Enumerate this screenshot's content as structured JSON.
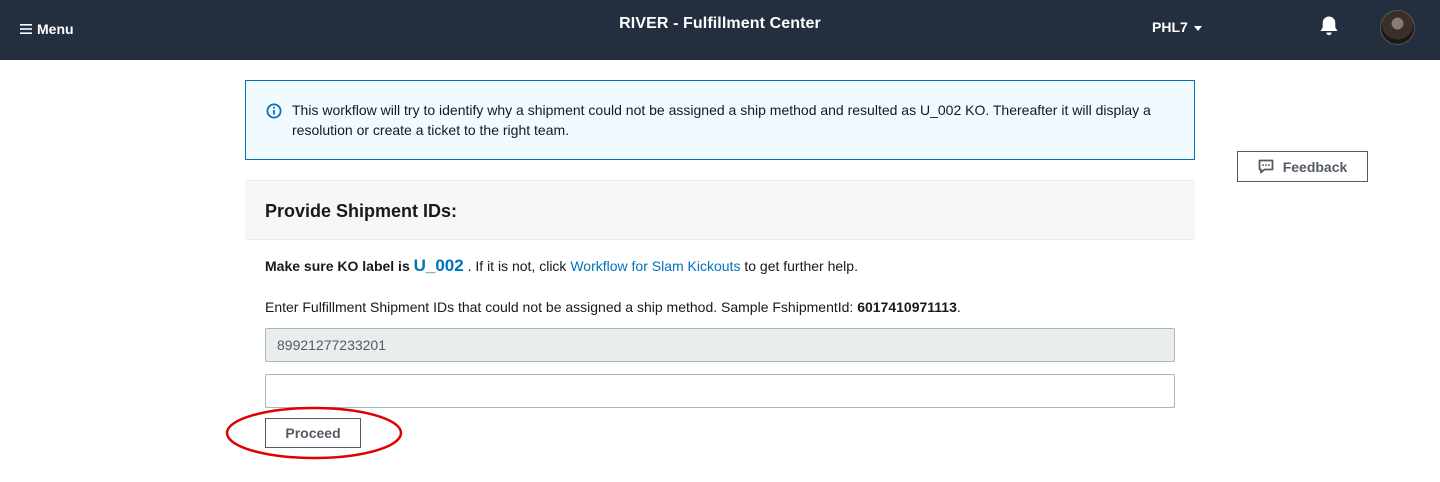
{
  "topbar": {
    "menu_label": "Menu",
    "menu_icon": "hamburger-icon",
    "title": "RIVER - Fulfillment Center",
    "site": "PHL7",
    "site_icon": "caret-down-icon",
    "bell_icon": "bell-icon",
    "avatar_icon": "user-avatar",
    "background_color": "#232f3e"
  },
  "info_banner": {
    "icon": "info-icon",
    "text": "This workflow will try to identify why a shipment could not be assigned a ship method and resulted as U_002 KO. Thereafter it will display a resolution or create a ticket to the right team.",
    "accent_color": "#0073bb"
  },
  "feedback": {
    "label": "Feedback",
    "icon": "comment-icon"
  },
  "panel": {
    "title": "Provide Shipment IDs:",
    "ko_prefix": "Make sure KO label is ",
    "ko_code": "U_002",
    "ko_middle": " . If it is not, click ",
    "ko_link": "Workflow for Slam Kickouts",
    "ko_suffix": " to get further help.",
    "instruction": "Enter Fulfillment Shipment IDs that could not be assigned a ship method. Sample FshipmentId: ",
    "sample_id": "6017410971113",
    "sample_suffix": ".",
    "inputs": [
      {
        "value": "89921277233201"
      },
      {
        "value": ""
      }
    ],
    "proceed_label": "Proceed"
  },
  "annotation": {
    "shape": "ellipse",
    "color": "#e00000"
  }
}
